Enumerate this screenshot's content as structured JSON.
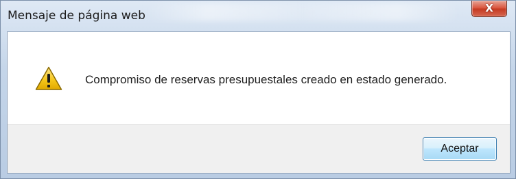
{
  "dialog": {
    "title": "Mensaje de página web",
    "close_label": "X",
    "message": "Compromiso de reservas presupuestales creado en estado generado.",
    "icon": "warning-icon",
    "accept_label": "Aceptar"
  },
  "colors": {
    "warning_fill": "#f5c518",
    "close_button": "#d9533c",
    "accept_border": "#3c7fb1"
  }
}
